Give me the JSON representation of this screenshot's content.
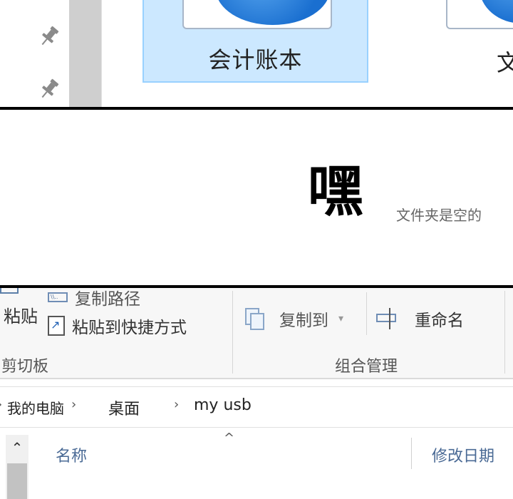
{
  "panel1": {
    "folders": [
      {
        "label": "会计账本",
        "selected": true
      },
      {
        "label": "文",
        "selected": false
      }
    ],
    "pinned_icons": [
      "pin-icon",
      "pin-icon"
    ]
  },
  "ribbon": {
    "clipboard": {
      "paste_label": "粘贴",
      "copy_path_label": "复制路径",
      "paste_shortcut_label": "粘贴到快捷方式",
      "group_label": "剪切板"
    },
    "organize": {
      "copy_to_label": "复制到",
      "rename_label": "重命名",
      "group_label": "组合管理"
    }
  },
  "address": {
    "crumbs": [
      "我的电脑",
      "桌面",
      "my usb"
    ]
  },
  "list": {
    "columns": [
      "名称",
      "修改日期"
    ],
    "sort_indicator": "^",
    "partial_row_text": "文件夹是空的"
  },
  "sfx_text": "嘿",
  "colors": {
    "selection_bg": "#cce8ff",
    "selection_border": "#99d1ff",
    "folder_blue": "#1a6fd0",
    "header_text": "#4a6a95"
  }
}
